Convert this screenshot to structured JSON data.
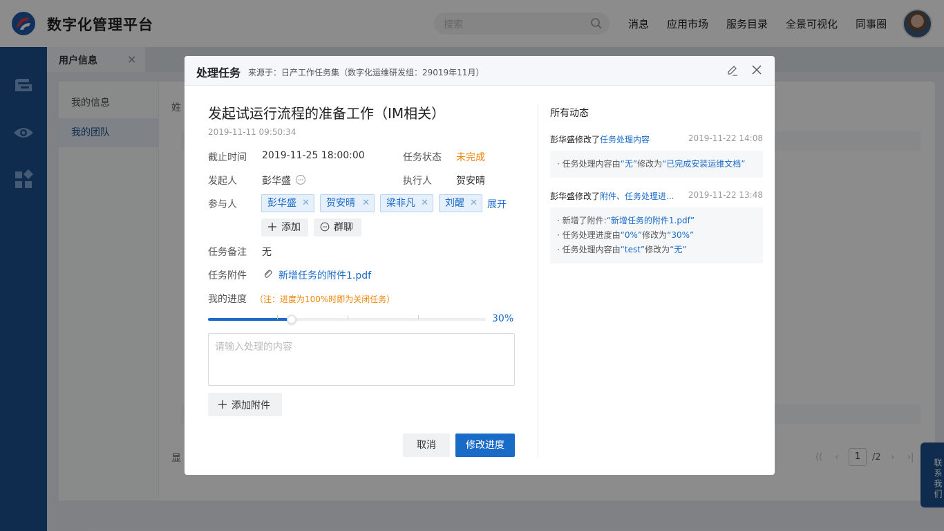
{
  "header": {
    "app_title": "数字化管理平台",
    "search_placeholder": "搜索",
    "nav": [
      "消息",
      "应用市场",
      "服务目录",
      "全景可视化",
      "同事圈"
    ]
  },
  "rail": {
    "icons": [
      "wallet-icon",
      "eye-icon",
      "apps-icon"
    ]
  },
  "background": {
    "tab_label": "用户信息",
    "tab_close": "×",
    "side_items": [
      "我的信息",
      "我的团队"
    ],
    "cut_label_1": "姓",
    "cut_label_2": "显",
    "pager_page": "1",
    "pager_total": "/2",
    "contact": "联系我们"
  },
  "modal": {
    "title": "处理任务",
    "source": "来源于：日产工作任务集（数字化运维研发组：29019年11月）",
    "task_title": "发起试运行流程的准备工作（IM相关）",
    "created_time": "2019-11-11   09:50:34",
    "fields": {
      "deadline_label": "截止时间",
      "deadline_value": "2019-11-25 18:00:00",
      "status_label": "任务状态",
      "status_value": "未完成",
      "initiator_label": "发起人",
      "initiator_value": "彭华盛",
      "executor_label": "执行人",
      "executor_value": "贺安晴",
      "participants_label": "参与人",
      "participants": [
        "彭华盛",
        "贺安晴",
        "梁非凡",
        "刘醒"
      ],
      "expand_label": "展开",
      "add_label": "添加",
      "group_chat_label": "群聊",
      "remark_label": "任务备注",
      "remark_value": "无",
      "attachment_label": "任务附件",
      "attachment_value": "新增任务的附件1.pdf",
      "progress_label": "我的进度",
      "progress_note": "（注：进度为100%时即为关闭任务）",
      "progress_value": 30,
      "progress_text": "30%"
    },
    "textarea_placeholder": "请输入处理的内容",
    "add_attachment_label": "添加附件",
    "cancel_label": "取消",
    "submit_label": "修改进度",
    "activity": {
      "title": "所有动态",
      "items": [
        {
          "who": "彭华盛修改了",
          "what": "任务处理内容",
          "when": "2019-11-22 14:08",
          "lines": [
            {
              "pre": "· 任务处理内容由",
              "a": "“无”",
              "mid": "修改为",
              "b": "“已完成安装运维文档”"
            }
          ]
        },
        {
          "who": "彭华盛修改了",
          "what": "附件、任务处理进...",
          "when": "2019-11-22 13:48",
          "lines": [
            {
              "pre": "· 新增了附件:",
              "a": "“新增任务的附件1.pdf”",
              "mid": "",
              "b": ""
            },
            {
              "pre": "· 任务处理进度由",
              "a": "“0%”",
              "mid": "修改为",
              "b": "“30%”"
            },
            {
              "pre": "· 任务处理内容由",
              "a": "“test”",
              "mid": "修改为",
              "b": "“无”"
            }
          ]
        }
      ]
    }
  }
}
